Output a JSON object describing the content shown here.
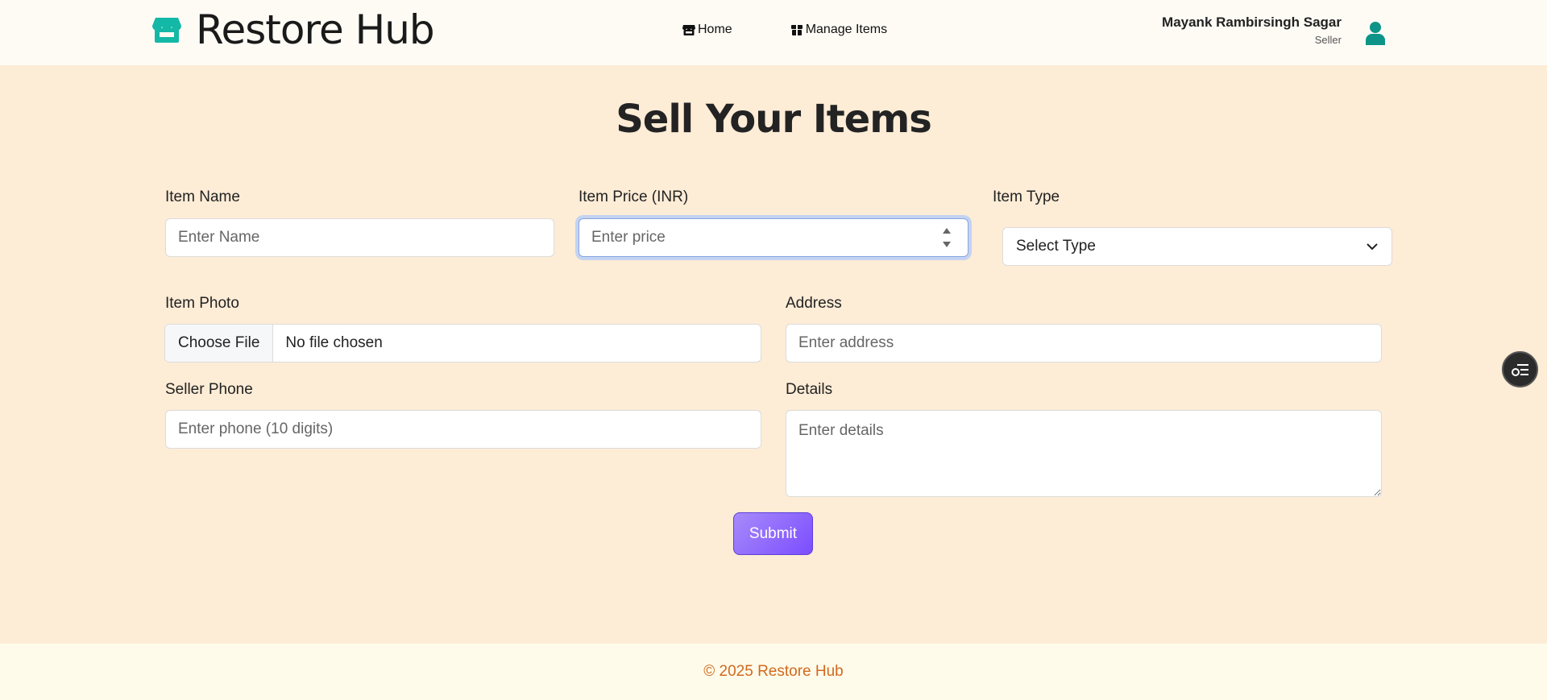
{
  "brand": {
    "name": "Restore Hub",
    "icon": "store-icon"
  },
  "nav": {
    "items": [
      {
        "label": "Home",
        "icon": "store-icon"
      },
      {
        "label": "Manage Items",
        "icon": "box-icon"
      }
    ]
  },
  "user": {
    "name": "Mayank Rambirsingh Sagar",
    "role": "Seller",
    "icon": "user-icon"
  },
  "page": {
    "title": "Sell Your Items"
  },
  "form": {
    "item_name": {
      "label": "Item Name",
      "placeholder": "Enter Name",
      "value": ""
    },
    "item_price": {
      "label": "Item Price (INR)",
      "placeholder": "Enter price",
      "value": ""
    },
    "item_type": {
      "label": "Item Type",
      "selected": "Select Type"
    },
    "item_photo": {
      "label": "Item Photo",
      "button": "Choose File",
      "status": "No file chosen"
    },
    "address": {
      "label": "Address",
      "placeholder": "Enter address",
      "value": ""
    },
    "seller_phone": {
      "label": "Seller Phone",
      "placeholder": "Enter phone (10 digits)",
      "value": ""
    },
    "details": {
      "label": "Details",
      "placeholder": "Enter details",
      "value": ""
    },
    "submit_label": "Submit"
  },
  "footer": {
    "text": "© 2025 Restore Hub"
  },
  "colors": {
    "background": "#fdecd6",
    "navbar": "#fefbf5",
    "brand_teal": "#0d9488",
    "submit_gradient_start": "#a78bfa",
    "submit_gradient_end": "#7c4dff",
    "footer_text": "#d2691e"
  }
}
